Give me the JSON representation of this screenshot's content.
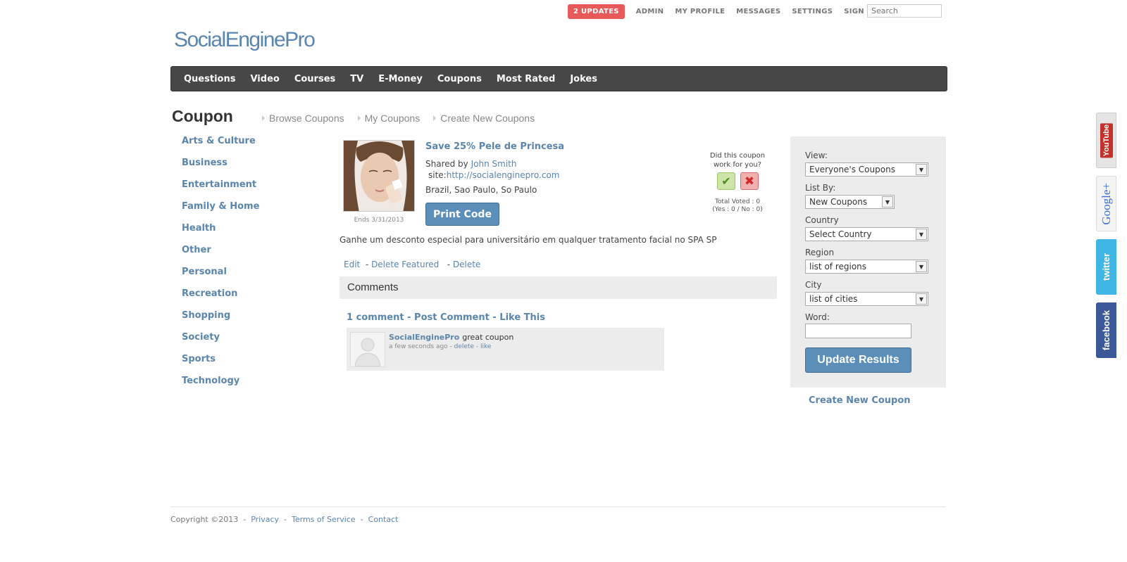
{
  "header": {
    "updates_badge": "2 UPDATES",
    "links": [
      "ADMIN",
      "MY PROFILE",
      "MESSAGES",
      "SETTINGS",
      "SIGN OUT"
    ],
    "search_placeholder": "Search",
    "logo": "SocialEnginePro"
  },
  "main_nav": [
    "Questions",
    "Video",
    "Courses",
    "TV",
    "E-Money",
    "Coupons",
    "Most Rated",
    "Jokes"
  ],
  "page": {
    "title": "Coupon",
    "subnav": [
      "Browse Coupons",
      "My Coupons",
      "Create New Coupons"
    ]
  },
  "categories": [
    "Arts & Culture",
    "Business",
    "Entertainment",
    "Family & Home",
    "Health",
    "Other",
    "Personal",
    "Recreation",
    "Shopping",
    "Society",
    "Sports",
    "Technology"
  ],
  "coupon": {
    "ends": "Ends  3/31/2013",
    "title": "Save 25% Pele de Princesa",
    "shared_by_label": "Shared by",
    "author": "John Smith",
    "site_label": "site:",
    "site_url": "http://socialenginepro.com",
    "location": "Brazil, Sao Paulo, So Paulo",
    "print_button": "Print Code",
    "vote_question": "Did this coupon work for you?",
    "vote_total": "Total Voted : 0",
    "vote_breakdown": "(Yes : 0 / No : 0)",
    "description": "Ganhe um desconto especial para universitário em qualquer tratamento facial no SPA SP",
    "actions": {
      "edit": "Edit",
      "delete_featured": "Delete Featured",
      "delete": "Delete",
      "separator": "-"
    }
  },
  "comments": {
    "header": "Comments",
    "count": "1 comment",
    "post_comment": "Post Comment",
    "like_this": "Like This",
    "items": [
      {
        "author": "SocialEnginePro",
        "text": "great coupon",
        "time": "a few seconds ago",
        "delete": "delete",
        "like": "like"
      }
    ]
  },
  "filters": {
    "view_label": "View:",
    "view_value": "Everyone's Coupons",
    "list_by_label": "List By:",
    "list_by_value": "New Coupons",
    "country_label": "Country",
    "country_value": "Select Country",
    "region_label": "Region",
    "region_value": "list of regions",
    "city_label": "City",
    "city_value": "list of cities",
    "word_label": "Word:",
    "word_value": "",
    "update_button": "Update Results",
    "create_link": "Create New Coupon"
  },
  "footer": {
    "copyright": "Copyright ©2013",
    "links": [
      "Privacy",
      "Terms of Service",
      "Contact"
    ]
  },
  "social": [
    "YouTube",
    "Google+",
    "twitter",
    "facebook"
  ],
  "colors": {
    "link": "#5a85ad",
    "nav_bg": "#474747",
    "badge": "#e85a5a",
    "button": "#5b8fb9"
  }
}
